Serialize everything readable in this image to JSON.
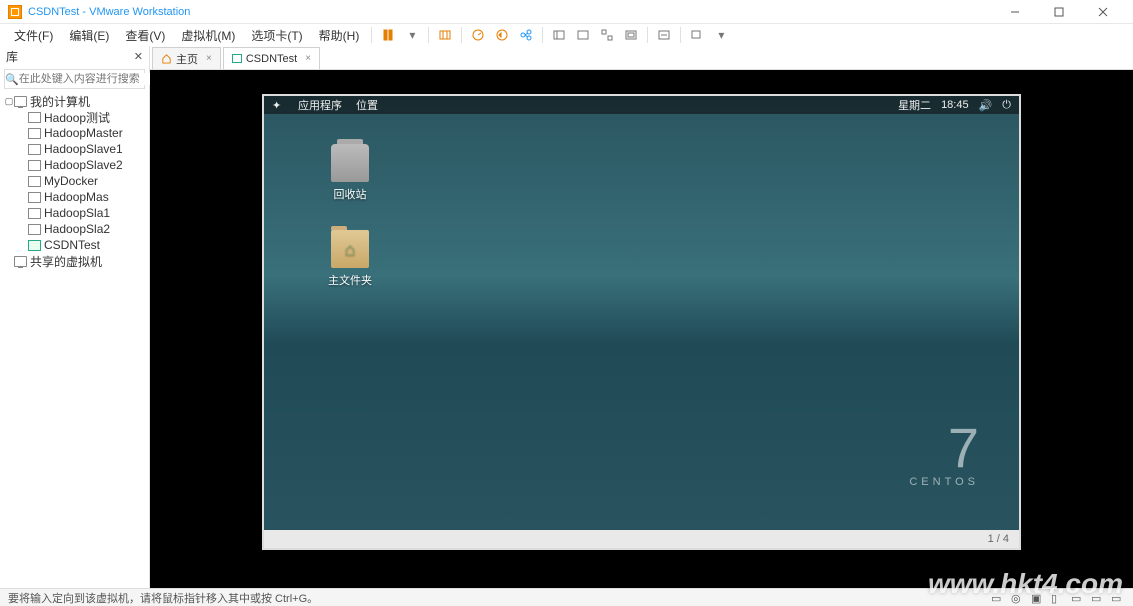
{
  "titlebar": {
    "title": "CSDNTest - VMware Workstation"
  },
  "menu": {
    "file": "文件(F)",
    "edit": "编辑(E)",
    "view": "查看(V)",
    "vm": "虚拟机(M)",
    "tabs": "选项卡(T)",
    "help": "帮助(H)"
  },
  "sidebar": {
    "header": "库",
    "search_placeholder": "在此处键入内容进行搜索",
    "root": "我的计算机",
    "items": [
      {
        "label": "Hadoop测试"
      },
      {
        "label": "HadoopMaster"
      },
      {
        "label": "HadoopSlave1"
      },
      {
        "label": "HadoopSlave2"
      },
      {
        "label": "MyDocker"
      },
      {
        "label": "HadoopMas"
      },
      {
        "label": "HadoopSla1"
      },
      {
        "label": "HadoopSla2"
      },
      {
        "label": "CSDNTest",
        "on": true
      }
    ],
    "shared": "共享的虚拟机"
  },
  "tabs": {
    "home": "主页",
    "active": "CSDNTest"
  },
  "guest": {
    "menu_app": "应用程序",
    "menu_loc": "位置",
    "day": "星期二",
    "time": "18:45",
    "trash": "回收站",
    "home": "主文件夹",
    "os_name": "CENTOS",
    "os_ver": "7",
    "page": "1 / 4"
  },
  "status": {
    "hint": "要将输入定向到该虚拟机，请将鼠标指针移入其中或按 Ctrl+G。"
  },
  "watermark": "www.hkt4.com"
}
